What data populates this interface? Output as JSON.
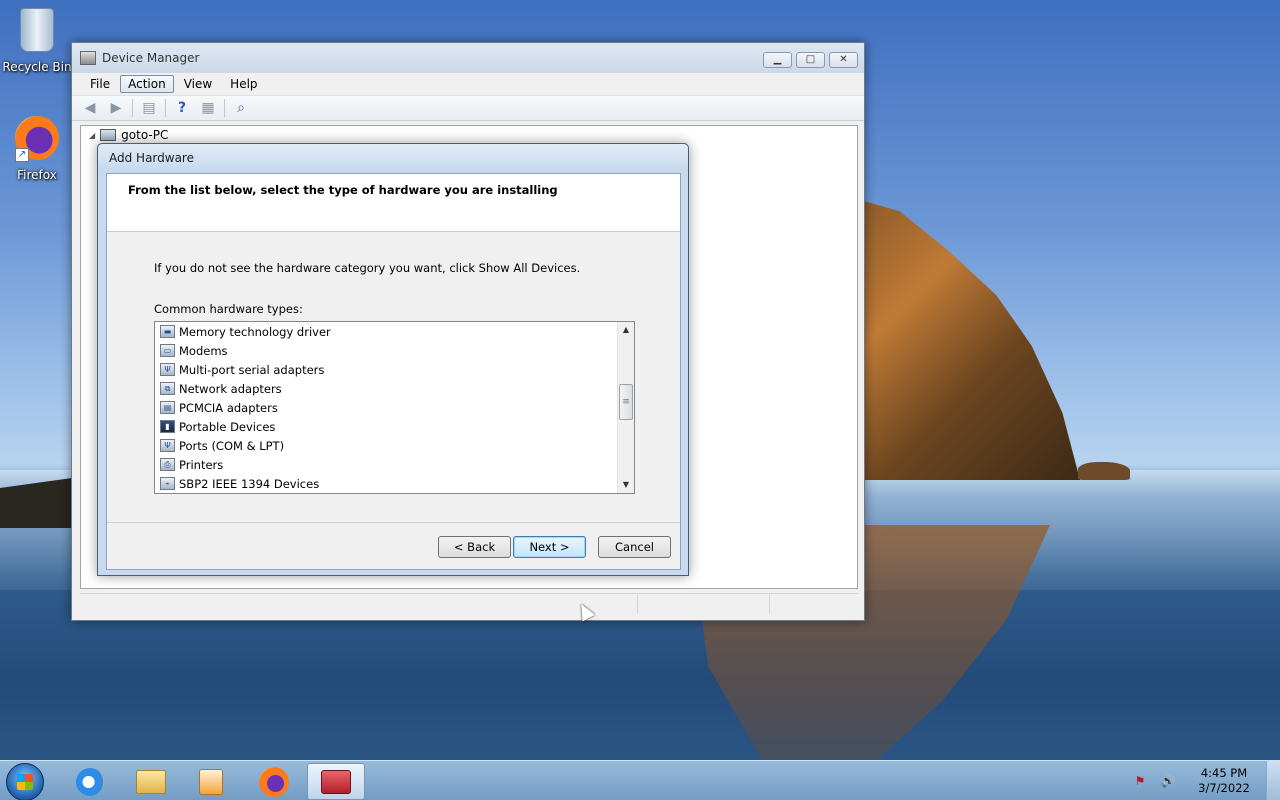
{
  "desktop": {
    "icons": [
      {
        "label": "Recycle Bin",
        "icon": "recycle-bin-icon"
      },
      {
        "label": "Firefox",
        "icon": "firefox-icon"
      }
    ]
  },
  "device_manager": {
    "title": "Device Manager",
    "menu": [
      "File",
      "Action",
      "View",
      "Help"
    ],
    "active_menu": "Action",
    "toolbar_icons": [
      "back-arrow-icon",
      "forward-arrow-icon",
      "show-hide-console-tree-icon",
      "help-icon",
      "properties-icon",
      "scan-hardware-icon"
    ],
    "tree_root": "goto-PC"
  },
  "add_hardware": {
    "title": "Add Hardware",
    "heading": "From the list below, select the type of hardware you are installing",
    "info": "If you do not see the hardware category you want, click Show All Devices.",
    "list_label": "Common hardware types:",
    "items": [
      {
        "label": "Memory technology driver",
        "icon": "memory-driver-icon"
      },
      {
        "label": "Modems",
        "icon": "modem-icon"
      },
      {
        "label": "Multi-port serial adapters",
        "icon": "serial-adapter-icon"
      },
      {
        "label": "Network adapters",
        "icon": "network-adapter-icon"
      },
      {
        "label": "PCMCIA adapters",
        "icon": "pcmcia-adapter-icon"
      },
      {
        "label": "Portable Devices",
        "icon": "portable-device-icon"
      },
      {
        "label": "Ports (COM & LPT)",
        "icon": "port-icon"
      },
      {
        "label": "Printers",
        "icon": "printer-icon"
      },
      {
        "label": "SBP2 IEEE 1394 Devices",
        "icon": "sbp2-device-icon"
      }
    ],
    "buttons": {
      "back": "< Back",
      "next": "Next >",
      "cancel": "Cancel"
    }
  },
  "taskbar": {
    "apps": [
      "internet-explorer-icon",
      "windows-explorer-icon",
      "media-player-icon",
      "firefox-icon",
      "toolbox-icon"
    ],
    "active_app": "toolbox-icon",
    "time": "4:45 PM",
    "date": "3/7/2022"
  }
}
